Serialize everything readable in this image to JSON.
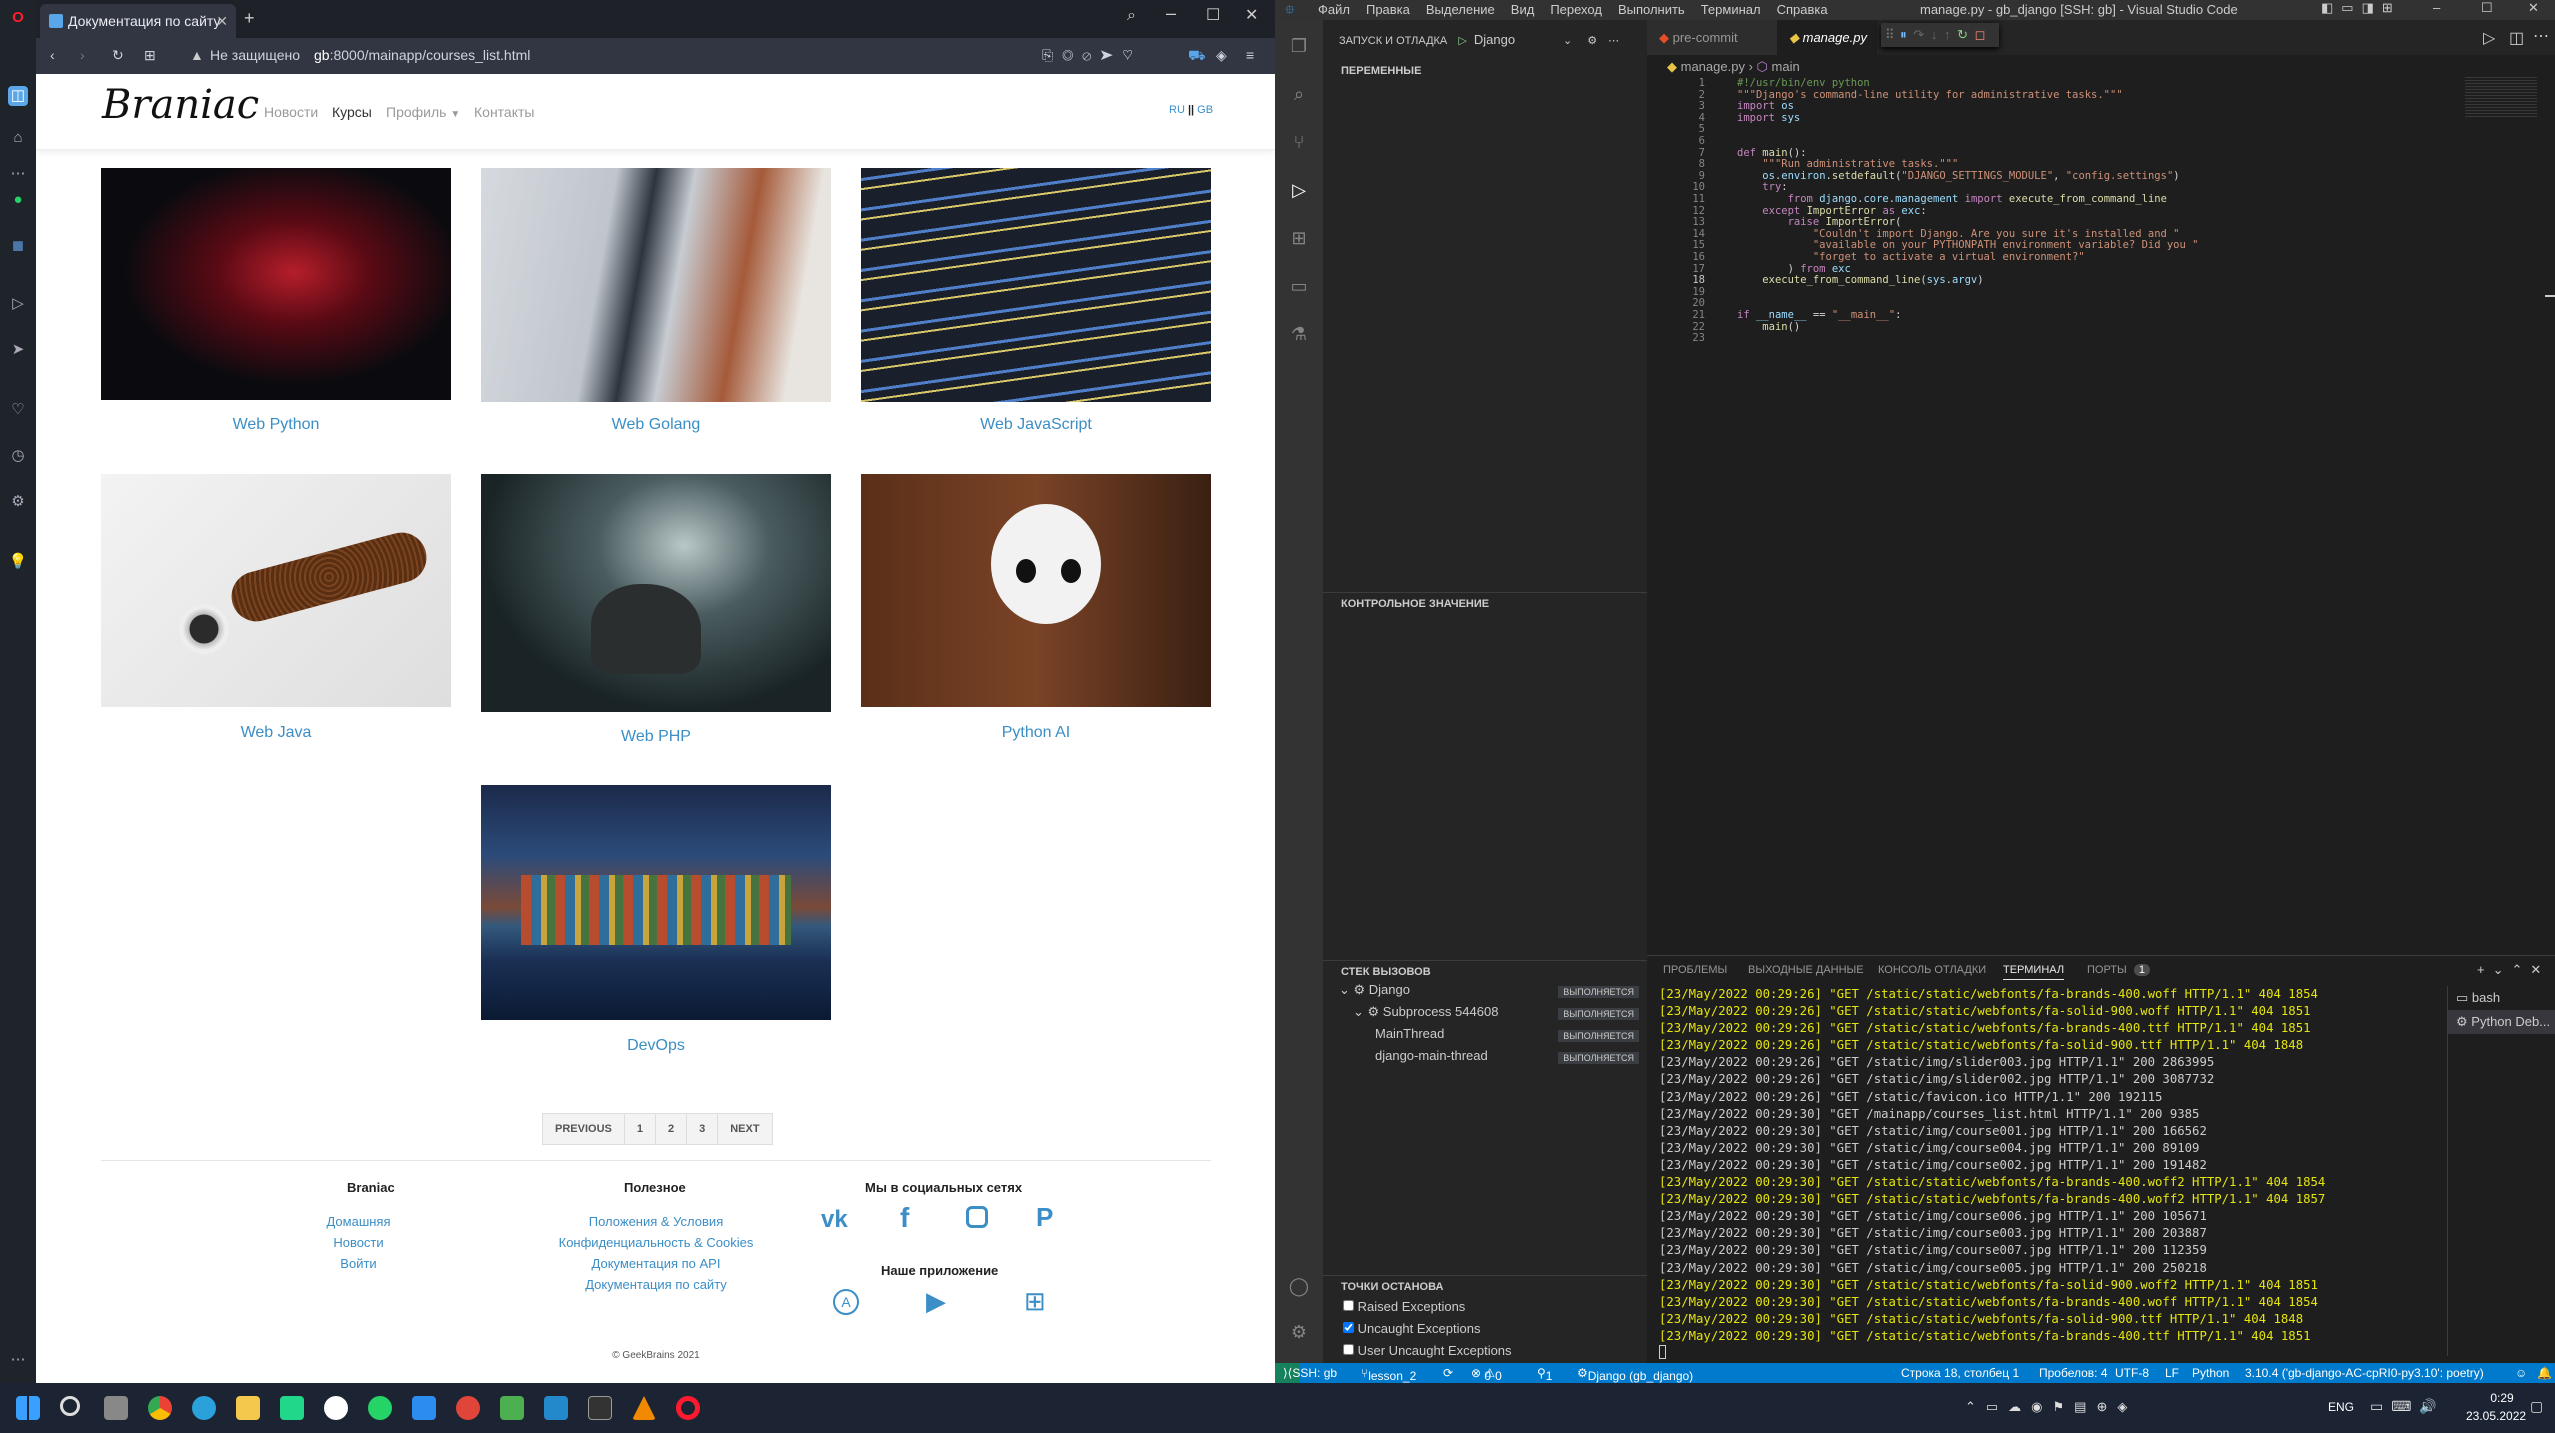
{
  "browser": {
    "tab_title": "Документация по сайту",
    "security": "Не защищено",
    "url_host": "gb",
    "url_rest": ":8000/mainapp/courses_list.html"
  },
  "site": {
    "logo": "Braniac",
    "nav": [
      "Новости",
      "Курсы",
      "Профиль",
      "Контакты"
    ],
    "lang_ru": "RU",
    "lang_gb": "GB",
    "courses": [
      {
        "title": "Web Python"
      },
      {
        "title": "Web Golang"
      },
      {
        "title": "Web JavaScript"
      },
      {
        "title": "Web Java"
      },
      {
        "title": "Web PHP"
      },
      {
        "title": "Python AI"
      },
      {
        "title": "DevOps"
      }
    ],
    "pagination": [
      "PREVIOUS",
      "1",
      "2",
      "3",
      "NEXT"
    ],
    "footer": {
      "col1_title": "Braniac",
      "col1_links": [
        "Домашняя",
        "Новости",
        "Войти"
      ],
      "col2_title": "Полезное",
      "col2_links": [
        "Положения & Условия",
        "Конфиденциальность & Cookies",
        "Документация по API",
        "Документация по сайту"
      ],
      "col3_title": "Мы в социальных сетях",
      "app_title": "Наше приложение",
      "copyright": "© GeekBrains 2021"
    }
  },
  "vscode": {
    "menu": [
      "Файл",
      "Правка",
      "Выделение",
      "Вид",
      "Переход",
      "Выполнить",
      "Терминал",
      "Справка"
    ],
    "window_title": "manage.py - gb_django [SSH: gb] - Visual Studio Code",
    "run_header": "ЗАПУСК И ОТЛАДКА",
    "run_config": "Django",
    "sections": {
      "variables": "ПЕРЕМЕННЫЕ",
      "watch": "КОНТРОЛЬНОЕ ЗНАЧЕНИЕ",
      "callstack": "СТЕК ВЫЗОВОВ",
      "breakpoints": "ТОЧКИ ОСТАНОВА"
    },
    "callstack": [
      {
        "name": "Django",
        "status": "ВЫПОЛНЯЕТСЯ"
      },
      {
        "name": "Subprocess 544608",
        "status": "ВЫПОЛНЯЕТСЯ"
      },
      {
        "name": "MainThread",
        "status": "ВЫПОЛНЯЕТСЯ"
      },
      {
        "name": "django-main-thread",
        "status": "ВЫПОЛНЯЕТСЯ"
      }
    ],
    "breakpoints": [
      {
        "label": "Raised Exceptions",
        "checked": false
      },
      {
        "label": "Uncaught Exceptions",
        "checked": true
      },
      {
        "label": "User Uncaught Exceptions",
        "checked": false
      }
    ],
    "tabs": [
      "pre-commit",
      "manage.py"
    ],
    "breadcrumb": [
      "manage.py",
      "main"
    ],
    "code_lines": [
      "#!/usr/bin/env python",
      "\"\"\"Django's command-line utility for administrative tasks.\"\"\"",
      "import os",
      "import sys",
      "",
      "",
      "def main():",
      "    \"\"\"Run administrative tasks.\"\"\"",
      "    os.environ.setdefault(\"DJANGO_SETTINGS_MODULE\", \"config.settings\")",
      "    try:",
      "        from django.core.management import execute_from_command_line",
      "    except ImportError as exc:",
      "        raise ImportError(",
      "            \"Couldn't import Django. Are you sure it's installed and \"",
      "            \"available on your PYTHONPATH environment variable? Did you \"",
      "            \"forget to activate a virtual environment?\"",
      "        ) from exc",
      "    execute_from_command_line(sys.argv)",
      "",
      "",
      "if __name__ == \"__main__\":",
      "    main()",
      ""
    ],
    "panel_tabs": [
      "ПРОБЛЕМЫ",
      "ВЫХОДНЫЕ ДАННЫЕ",
      "КОНСОЛЬ ОТЛАДКИ",
      "ТЕРМИНАЛ",
      "ПОРТЫ"
    ],
    "ports_count": "1",
    "terminals": [
      "bash",
      "Python Deb..."
    ],
    "terminal_lines": [
      {
        "text": "[23/May/2022 00:29:26] \"GET /static/static/webfonts/fa-brands-400.woff HTTP/1.1\" 404 1854",
        "warn": true
      },
      {
        "text": "[23/May/2022 00:29:26] \"GET /static/static/webfonts/fa-solid-900.woff HTTP/1.1\" 404 1851",
        "warn": true
      },
      {
        "text": "[23/May/2022 00:29:26] \"GET /static/static/webfonts/fa-brands-400.ttf HTTP/1.1\" 404 1851",
        "warn": true
      },
      {
        "text": "[23/May/2022 00:29:26] \"GET /static/static/webfonts/fa-solid-900.ttf HTTP/1.1\" 404 1848",
        "warn": true
      },
      {
        "text": "[23/May/2022 00:29:26] \"GET /static/img/slider003.jpg HTTP/1.1\" 200 2863995",
        "warn": false
      },
      {
        "text": "[23/May/2022 00:29:26] \"GET /static/img/slider002.jpg HTTP/1.1\" 200 3087732",
        "warn": false
      },
      {
        "text": "[23/May/2022 00:29:26] \"GET /static/favicon.ico HTTP/1.1\" 200 192115",
        "warn": false
      },
      {
        "text": "[23/May/2022 00:29:30] \"GET /mainapp/courses_list.html HTTP/1.1\" 200 9385",
        "warn": false
      },
      {
        "text": "[23/May/2022 00:29:30] \"GET /static/img/course001.jpg HTTP/1.1\" 200 166562",
        "warn": false
      },
      {
        "text": "[23/May/2022 00:29:30] \"GET /static/img/course004.jpg HTTP/1.1\" 200 89109",
        "warn": false
      },
      {
        "text": "[23/May/2022 00:29:30] \"GET /static/img/course002.jpg HTTP/1.1\" 200 191482",
        "warn": false
      },
      {
        "text": "[23/May/2022 00:29:30] \"GET /static/static/webfonts/fa-brands-400.woff2 HTTP/1.1\" 404 1854",
        "warn": true
      },
      {
        "text": "[23/May/2022 00:29:30] \"GET /static/static/webfonts/fa-brands-400.woff2 HTTP/1.1\" 404 1857",
        "warn": true
      },
      {
        "text": "[23/May/2022 00:29:30] \"GET /static/img/course006.jpg HTTP/1.1\" 200 105671",
        "warn": false
      },
      {
        "text": "[23/May/2022 00:29:30] \"GET /static/img/course003.jpg HTTP/1.1\" 200 203887",
        "warn": false
      },
      {
        "text": "[23/May/2022 00:29:30] \"GET /static/img/course007.jpg HTTP/1.1\" 200 112359",
        "warn": false
      },
      {
        "text": "[23/May/2022 00:29:30] \"GET /static/img/course005.jpg HTTP/1.1\" 200 250218",
        "warn": false
      },
      {
        "text": "[23/May/2022 00:29:30] \"GET /static/static/webfonts/fa-solid-900.woff2 HTTP/1.1\" 404 1851",
        "warn": true
      },
      {
        "text": "[23/May/2022 00:29:30] \"GET /static/static/webfonts/fa-brands-400.woff HTTP/1.1\" 404 1854",
        "warn": true
      },
      {
        "text": "[23/May/2022 00:29:30] \"GET /static/static/webfonts/fa-solid-900.ttf HTTP/1.1\" 404 1848",
        "warn": true
      },
      {
        "text": "[23/May/2022 00:29:30] \"GET /static/static/webfonts/fa-brands-400.ttf HTTP/1.1\" 404 1851",
        "warn": true
      }
    ],
    "status": {
      "remote": "SSH: gb",
      "branch": "lesson_2",
      "errors": "0",
      "warnings": "0",
      "debug_count": "1",
      "debug_config": "Django (gb_django)",
      "position": "Строка 18, столбец 1",
      "spaces": "Пробелов: 4",
      "encoding": "UTF-8",
      "eol": "LF",
      "language": "Python",
      "interpreter": "3.10.4 ('gb-django-AC-cpRI0-py3.10': poetry)"
    }
  },
  "taskbar": {
    "lang": "ENG",
    "time": "0:29",
    "date": "23.05.2022"
  },
  "colors": {
    "accent": "#3b8ec6",
    "vscode_status": "#007acc",
    "terminal_warn": "#e5e510"
  }
}
